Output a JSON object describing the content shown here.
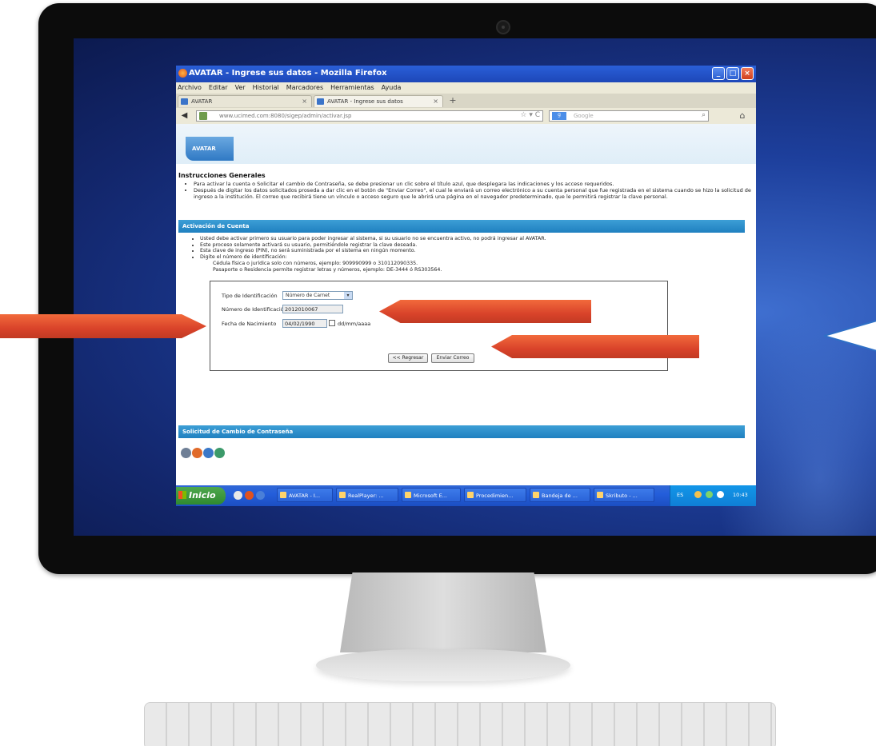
{
  "window": {
    "title": "AVATAR - Ingrese sus datos - Mozilla Firefox",
    "menu": [
      "Archivo",
      "Editar",
      "Ver",
      "Historial",
      "Marcadores",
      "Herramientas",
      "Ayuda"
    ]
  },
  "tabs": [
    {
      "label": "AVATAR"
    },
    {
      "label": "AVATAR - Ingrese sus datos"
    }
  ],
  "navbar": {
    "url": "www.ucimed.com:8080/sigep/admin/activar.jsp",
    "search_placeholder": "Google"
  },
  "page": {
    "logo": "AVATAR",
    "instructions_title": "Instrucciones Generales",
    "instructions": [
      "Para activar la cuenta o Solicitar el cambio de Contraseña, se debe presionar un clic sobre el título azul, que desplegara las indicaciones y los acceso requeridos.",
      "Después de digitar los datos solicitados proseda a dar clic en el botón de \"Enviar Correo\", el cual le enviará un correo electrónico a su cuenta personal que fue registrada en el sistema cuando se hizo la solicitud de ingreso a la institución. El correo que recibirá tiene un vínculo o acceso seguro que le abrirá una página en el navegador predeterminado, que le permitirá registrar la clave personal."
    ],
    "section_activation": "Activación de Cuenta",
    "activation_items": [
      "Usted debe activar primero su usuario para poder ingresar al sistema, si su usuario no se encuentra activo, no podrá ingresar al AVATAR.",
      "Este proceso solamente activará su usuario, permitiéndole registrar la clave deseada.",
      "Esta clave de ingreso (PIN), no será suministrada por el sistema en ningún momento.",
      "Digite el número de identificación:"
    ],
    "activation_sub": [
      "Cédula física o jurídica solo con números, ejemplo: 909990999 o 310112090335.",
      "Pasaporte o Residencia permite registrar letras y números, ejemplo: DE-3444 ó RS303564."
    ],
    "form": {
      "tipo_label": "Tipo de Identificación",
      "tipo_value": "Número de Carnet",
      "numero_label": "Número de Identificación",
      "numero_value": "2012010067",
      "fecha_label": "Fecha de Nacimiento",
      "fecha_value": "04/02/1990",
      "fecha_format": "dd/mm/aaaa",
      "back_button": "<< Regresar",
      "send_button": "Enviar Correo"
    },
    "section_password": "Solicitud de Cambio de Contraseña"
  },
  "taskbar": {
    "start": "Inicio",
    "items": [
      "AVATAR - I...",
      "RealPlayer: ...",
      "Microsoft E...",
      "Procedimien...",
      "Bandeja de ...",
      "Skributo - ..."
    ],
    "lang": "ES",
    "clock": "10:43"
  },
  "colors": {
    "annotation_arrow": "#e4512f",
    "section_bar": "#2a8dcc",
    "xp_title": "#2458d0"
  }
}
